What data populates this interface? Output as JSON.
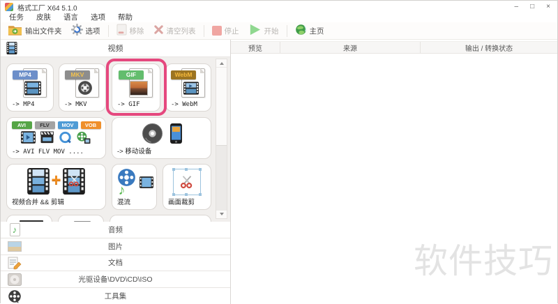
{
  "window": {
    "title": "格式工厂 X64 5.1.0",
    "controls": {
      "minimize": "–",
      "maximize": "□",
      "close": "×"
    }
  },
  "menu": {
    "items": [
      "任务",
      "皮肤",
      "语言",
      "选项",
      "帮助"
    ]
  },
  "toolbar": {
    "output_folder": "输出文件夹",
    "options": "选项",
    "remove": "移除",
    "clear_list": "清空列表",
    "stop": "停止",
    "start": "开始",
    "home": "主页"
  },
  "sidebar": {
    "video_header": "视频",
    "format_buttons": [
      {
        "label": "-> MP4",
        "badge": "MP4",
        "badge_color": "#6d8fc9",
        "highlighted": false
      },
      {
        "label": "-> MKV",
        "badge": "MKV",
        "badge_color": "#8d8d8d",
        "highlighted": false
      },
      {
        "label": "-> GIF",
        "badge": "GIF",
        "badge_color": "#63bd6d",
        "highlighted": true
      },
      {
        "label": "-> WebM",
        "badge": "WebM",
        "badge_color": "#9c7422",
        "highlighted": false
      }
    ],
    "avi_button": {
      "label": "-> AVI FLV MOV ....",
      "badges": [
        "AVI",
        "FLV",
        "MOV",
        "VOB"
      ]
    },
    "mobile_button": {
      "label": "-> 移动设备"
    },
    "tools_row": [
      {
        "label": "视频合并 && 剪辑"
      },
      {
        "label": "混流"
      },
      {
        "label": "画面裁剪"
      }
    ],
    "categories": [
      {
        "label": "音频"
      },
      {
        "label": "图片"
      },
      {
        "label": "文档"
      },
      {
        "label": "光驱设备\\DVD\\CD\\ISO"
      },
      {
        "label": "工具集"
      }
    ]
  },
  "main": {
    "columns": [
      "预览",
      "来源",
      "输出 / 转换状态"
    ],
    "watermark": "软件技巧"
  },
  "colors": {
    "highlight_pink": "#e5487e",
    "start_green": "#90d890",
    "stop_red": "#f0a6a2",
    "watermark_gray": "#e3e3e3"
  }
}
